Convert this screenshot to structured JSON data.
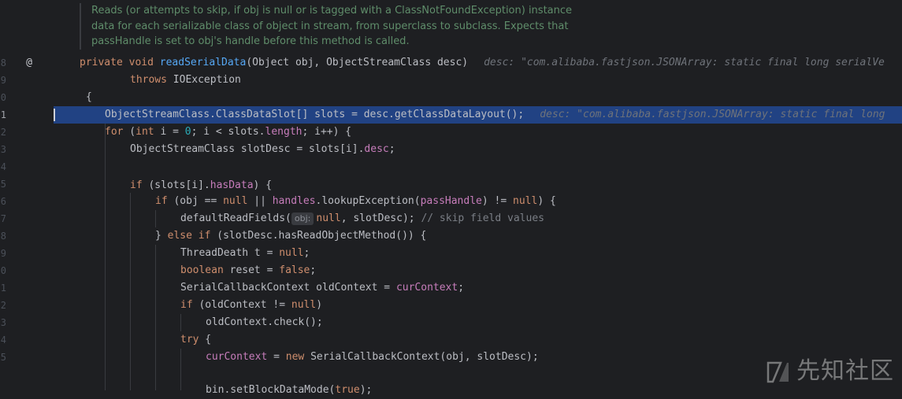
{
  "editor": {
    "doc_comment": [
      "Reads (or attempts to skip, if obj is null or is tagged with a ClassNotFoundException) instance",
      "data for each serializable class of object in stream, from superclass to subclass. Expects that",
      "passHandle is set to obj's handle before this method is called."
    ],
    "gutter": {
      "line_numbers": [
        "8",
        "9",
        "0",
        "1",
        "2",
        "3",
        "4",
        "5",
        "6",
        "7",
        "8",
        "9",
        "0",
        "1",
        "2",
        "3",
        "4",
        "5"
      ],
      "current_line_number": "1",
      "annotation_icon": "at-sign-icon",
      "annotation_glyph": "@"
    },
    "lines": {
      "l8": {
        "t1": "private",
        "t2": " ",
        "t3": "void",
        "t4": " ",
        "t5": "readSerialData",
        "t6": "(Object obj, ObjectStreamClass desc)",
        "hint": "desc: \"com.alibaba.fastjson.JSONArray: static final long serialVe"
      },
      "l9": {
        "t1": "throws",
        "t2": " IOException"
      },
      "l10": {
        "t1": "{"
      },
      "l11": {
        "t1": "ObjectStreamClass.ClassDataSlot[] slots = desc.getClassDataLayout();",
        "hint": "desc: \"com.alibaba.fastjson.JSONArray: static final long"
      },
      "l12": {
        "t1": "for",
        "t2": " (",
        "t3": "int",
        "t4": " i = ",
        "t5": "0",
        "t6": "; i < slots.",
        "t7": "length",
        "t8": "; i++) {"
      },
      "l13": {
        "t1": "ObjectStreamClass slotDesc = slots[i].",
        "t2": "desc",
        "t3": ";"
      },
      "l15": {
        "t1": "if",
        "t2": " (slots[i].",
        "t3": "hasData",
        "t4": ") {"
      },
      "l16": {
        "t1": "if",
        "t2": " (obj == ",
        "t3": "null",
        "t4": " || ",
        "t5": "handles",
        "t6": ".lookupException(",
        "t7": "passHandle",
        "t8": ") != ",
        "t9": "null",
        "t10": ") {"
      },
      "l17": {
        "t1": "defaultReadFields(",
        "inlay": "obj:",
        "t2": "null",
        "t3": ", slotDesc); ",
        "t4": "// skip field values"
      },
      "l18": {
        "t1": "} ",
        "t2": "else if",
        "t3": " (slotDesc.hasReadObjectMethod()) {"
      },
      "l19": {
        "t1": "ThreadDeath t = ",
        "t2": "null",
        "t3": ";"
      },
      "l20": {
        "t1": "boolean",
        "t2": " reset = ",
        "t3": "false",
        "t4": ";"
      },
      "l21": {
        "t1": "SerialCallbackContext oldContext = ",
        "t2": "curContext",
        "t3": ";"
      },
      "l22": {
        "t1": "if",
        "t2": " (oldContext != ",
        "t3": "null",
        "t4": ")"
      },
      "l23": {
        "t1": "oldContext.check();"
      },
      "l24": {
        "t1": "try",
        "t2": " {"
      },
      "l25": {
        "t1": "curContext",
        "t2": " = ",
        "t3": "new",
        "t4": " SerialCallbackContext(obj, slotDesc);"
      },
      "l27": {
        "t1": "bin.setBlockDataMode(",
        "t2": "true",
        "t3": ");"
      }
    }
  },
  "watermark": {
    "text": "先知社区",
    "logo_icon": "xianzhi-logo-icon"
  },
  "colors": {
    "background": "#1e1f22",
    "selection": "#214283",
    "keyword": "#cf8e6d",
    "method": "#56a8f5",
    "field": "#c77dbb",
    "number": "#2aacb8",
    "comment": "#7a7e85",
    "doc_comment": "#5f8d6a"
  }
}
